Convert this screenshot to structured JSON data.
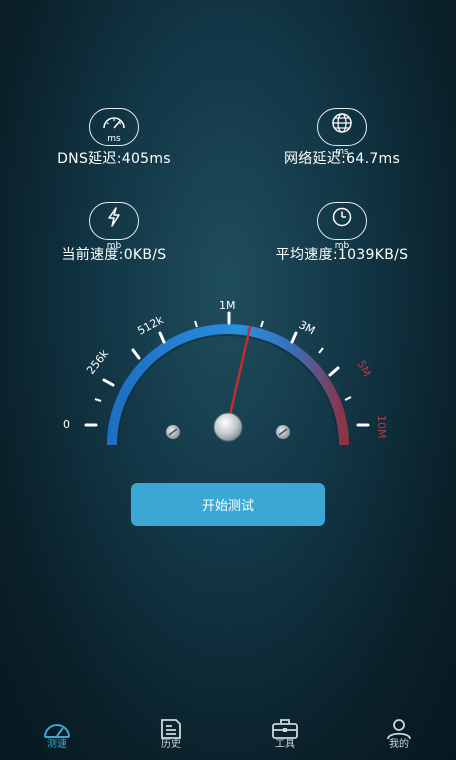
{
  "stats": {
    "dns": {
      "unit": "ms",
      "label": "DNS延迟:405ms",
      "icon": "speedometer-icon"
    },
    "net": {
      "unit": "ms",
      "label": "网络延迟:64.7ms",
      "icon": "globe-icon"
    },
    "cur": {
      "unit": "mb",
      "label": "当前速度:0KB/S",
      "icon": "lightning-icon"
    },
    "avg": {
      "unit": "mb",
      "label": "平均速度:1039KB/S",
      "icon": "clock-icon"
    }
  },
  "gauge": {
    "scale_labels": [
      "0",
      "256k",
      "512k",
      "1M",
      "3M",
      "5M",
      "10M"
    ],
    "needle_label": "1M"
  },
  "start_button": {
    "label": "开始测试"
  },
  "tabs": [
    {
      "label": "测速",
      "icon": "speedometer-icon",
      "active": true
    },
    {
      "label": "历史",
      "icon": "history-icon",
      "active": false
    },
    {
      "label": "工具",
      "icon": "toolbox-icon",
      "active": false
    },
    {
      "label": "我的",
      "icon": "user-icon",
      "active": false
    }
  ],
  "colors": {
    "accent": "#3aa7d4",
    "gauge_red": "#b03a4a",
    "background": "#123645"
  }
}
